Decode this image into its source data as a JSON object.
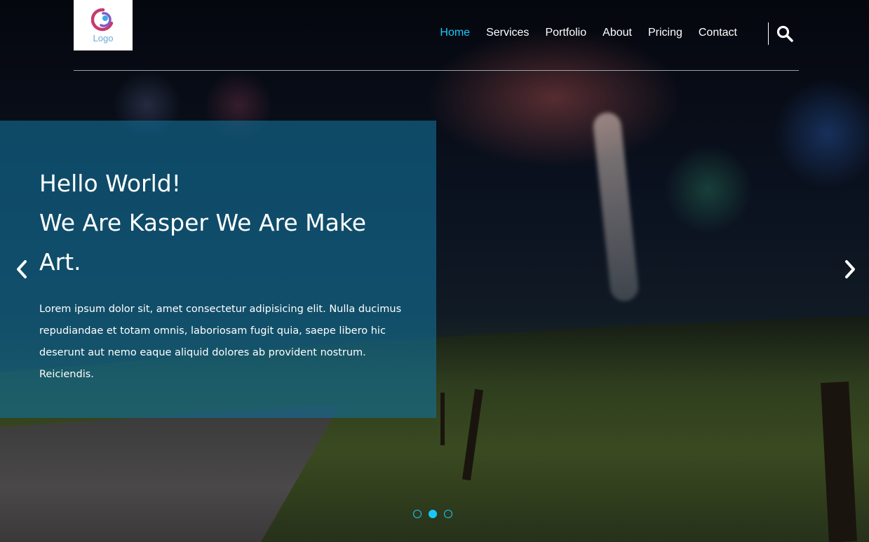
{
  "logo": {
    "text": "Logo"
  },
  "nav": {
    "items": [
      {
        "label": "Home",
        "active": true
      },
      {
        "label": "Services"
      },
      {
        "label": "Portfolio"
      },
      {
        "label": "About"
      },
      {
        "label": "Pricing"
      },
      {
        "label": "Contact"
      }
    ],
    "search_icon": "search-icon"
  },
  "hero": {
    "title_line1": "Hello World!",
    "title_line2": "We Are Kasper We Are Make Art.",
    "description": "Lorem ipsum dolor sit, amet consectetur adipisicing elit. Nulla ducimus repudiandae et totam omnis, laboriosam fugit quia, saepe libero hic deserunt aut nemo eaque aliquid dolores ab provident nostrum. Reiciendis.",
    "prev_icon": "chevron-left-icon",
    "next_icon": "chevron-right-icon"
  },
  "slider": {
    "slide_count": 3,
    "active_index": 1
  },
  "colors": {
    "accent": "#19c8fa",
    "panel": "#117096"
  }
}
